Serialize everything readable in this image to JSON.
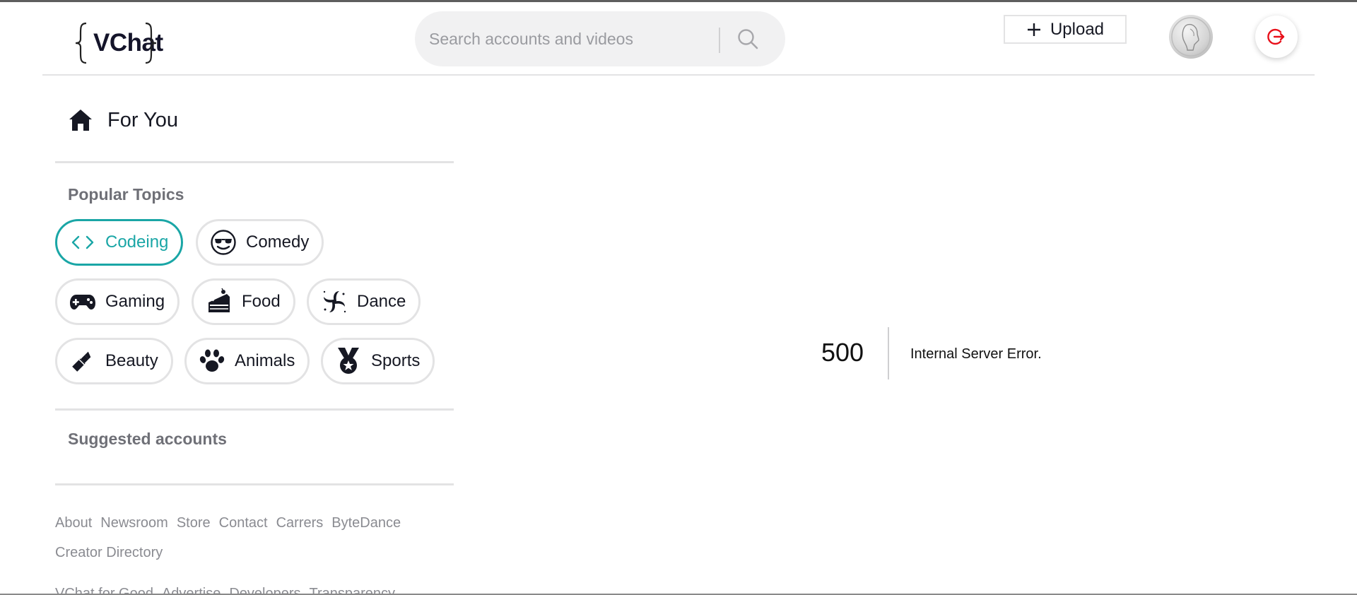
{
  "header": {
    "logo_text": "VChat",
    "search": {
      "placeholder": "Search accounts and videos",
      "value": ""
    },
    "upload_label": "Upload"
  },
  "sidebar": {
    "for_you_label": "For You",
    "popular_topics_title": "Popular Topics",
    "topics": [
      {
        "label": "Codeing",
        "icon": "code-icon",
        "active": true
      },
      {
        "label": "Comedy",
        "icon": "sunglasses-smile-icon",
        "active": false
      },
      {
        "label": "Gaming",
        "icon": "gamepad-icon",
        "active": false
      },
      {
        "label": "Food",
        "icon": "cake-icon",
        "active": false
      },
      {
        "label": "Dance",
        "icon": "dance-swirl-icon",
        "active": false
      },
      {
        "label": "Beauty",
        "icon": "lipstick-icon",
        "active": false
      },
      {
        "label": "Animals",
        "icon": "paw-icon",
        "active": false
      },
      {
        "label": "Sports",
        "icon": "medal-icon",
        "active": false
      }
    ],
    "suggested_accounts_title": "Suggested accounts",
    "footer_links_row1": [
      "About",
      "Newsroom",
      "Store",
      "Contact",
      "Carrers",
      "ByteDance",
      "Creator Directory"
    ],
    "footer_links_row2": [
      "VChat for Good",
      "Advertise",
      "Developers",
      "Transparency"
    ]
  },
  "main": {
    "error_code": "500",
    "error_message": "Internal Server Error."
  },
  "colors": {
    "accent": "#1aa6a6",
    "logout": "#e8101a"
  }
}
